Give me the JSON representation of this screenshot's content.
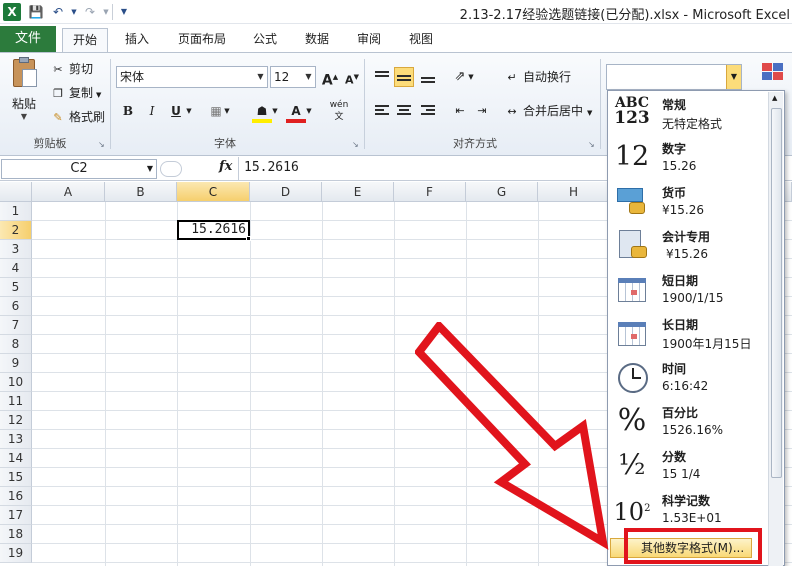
{
  "title_bar": {
    "app_icon": "X",
    "title": "2.13-2.17经验选题链接(已分配).xlsx - Microsoft Excel"
  },
  "tabs": [
    {
      "label": "文件"
    },
    {
      "label": "开始"
    },
    {
      "label": "插入"
    },
    {
      "label": "页面布局"
    },
    {
      "label": "公式"
    },
    {
      "label": "数据"
    },
    {
      "label": "审阅"
    },
    {
      "label": "视图"
    }
  ],
  "clipboard": {
    "group_label": "剪贴板",
    "paste": "粘贴",
    "cut": "剪切",
    "copy": "复制",
    "format_painter": "格式刷"
  },
  "font": {
    "group_label": "字体",
    "name": "宋体",
    "size": "12",
    "grow": "A",
    "shrink": "A",
    "bold": "B",
    "italic": "I",
    "underline": "U",
    "phonetic": "wén"
  },
  "alignment": {
    "group_label": "对齐方式",
    "wrap_text": "自动换行",
    "merge_center": "合并后居中"
  },
  "formula_bar": {
    "name_box": "C2",
    "fx": "fx",
    "value": "15.2616"
  },
  "sheet": {
    "columns": [
      "A",
      "B",
      "C",
      "D",
      "E",
      "F",
      "G",
      "H"
    ],
    "rows": [
      "1",
      "2",
      "3",
      "4",
      "5",
      "6",
      "7",
      "8",
      "9",
      "10",
      "11",
      "12",
      "13",
      "14",
      "15",
      "16",
      "17",
      "18",
      "19"
    ],
    "active_cell_value": "15.2616"
  },
  "number_format_dropdown": {
    "items": [
      {
        "name": "常规",
        "sample": "无特定格式",
        "icon": "abc-123-icon"
      },
      {
        "name": "数字",
        "sample": "15.26",
        "icon": "number-12-icon"
      },
      {
        "name": "货币",
        "sample": "¥15.26",
        "icon": "currency-icon"
      },
      {
        "name": "会计专用",
        "sample": "¥15.26",
        "icon": "accounting-icon"
      },
      {
        "name": "短日期",
        "sample": "1900/1/15",
        "icon": "calendar-icon"
      },
      {
        "name": "长日期",
        "sample": "1900年1月15日",
        "icon": "calendar-icon"
      },
      {
        "name": "时间",
        "sample": "6:16:42",
        "icon": "clock-icon"
      },
      {
        "name": "百分比",
        "sample": "1526.16%",
        "icon": "percent-icon"
      },
      {
        "name": "分数",
        "sample": "15 1/4",
        "icon": "fraction-icon"
      },
      {
        "name": "科学记数",
        "sample": "1.53E+01",
        "icon": "scientific-icon"
      }
    ],
    "more_formats": "其他数字格式(M)..."
  },
  "colors": {
    "file_tab": "#2c7b3c",
    "highlight": "#fcdc7a",
    "annotation_red": "#e1141c"
  }
}
